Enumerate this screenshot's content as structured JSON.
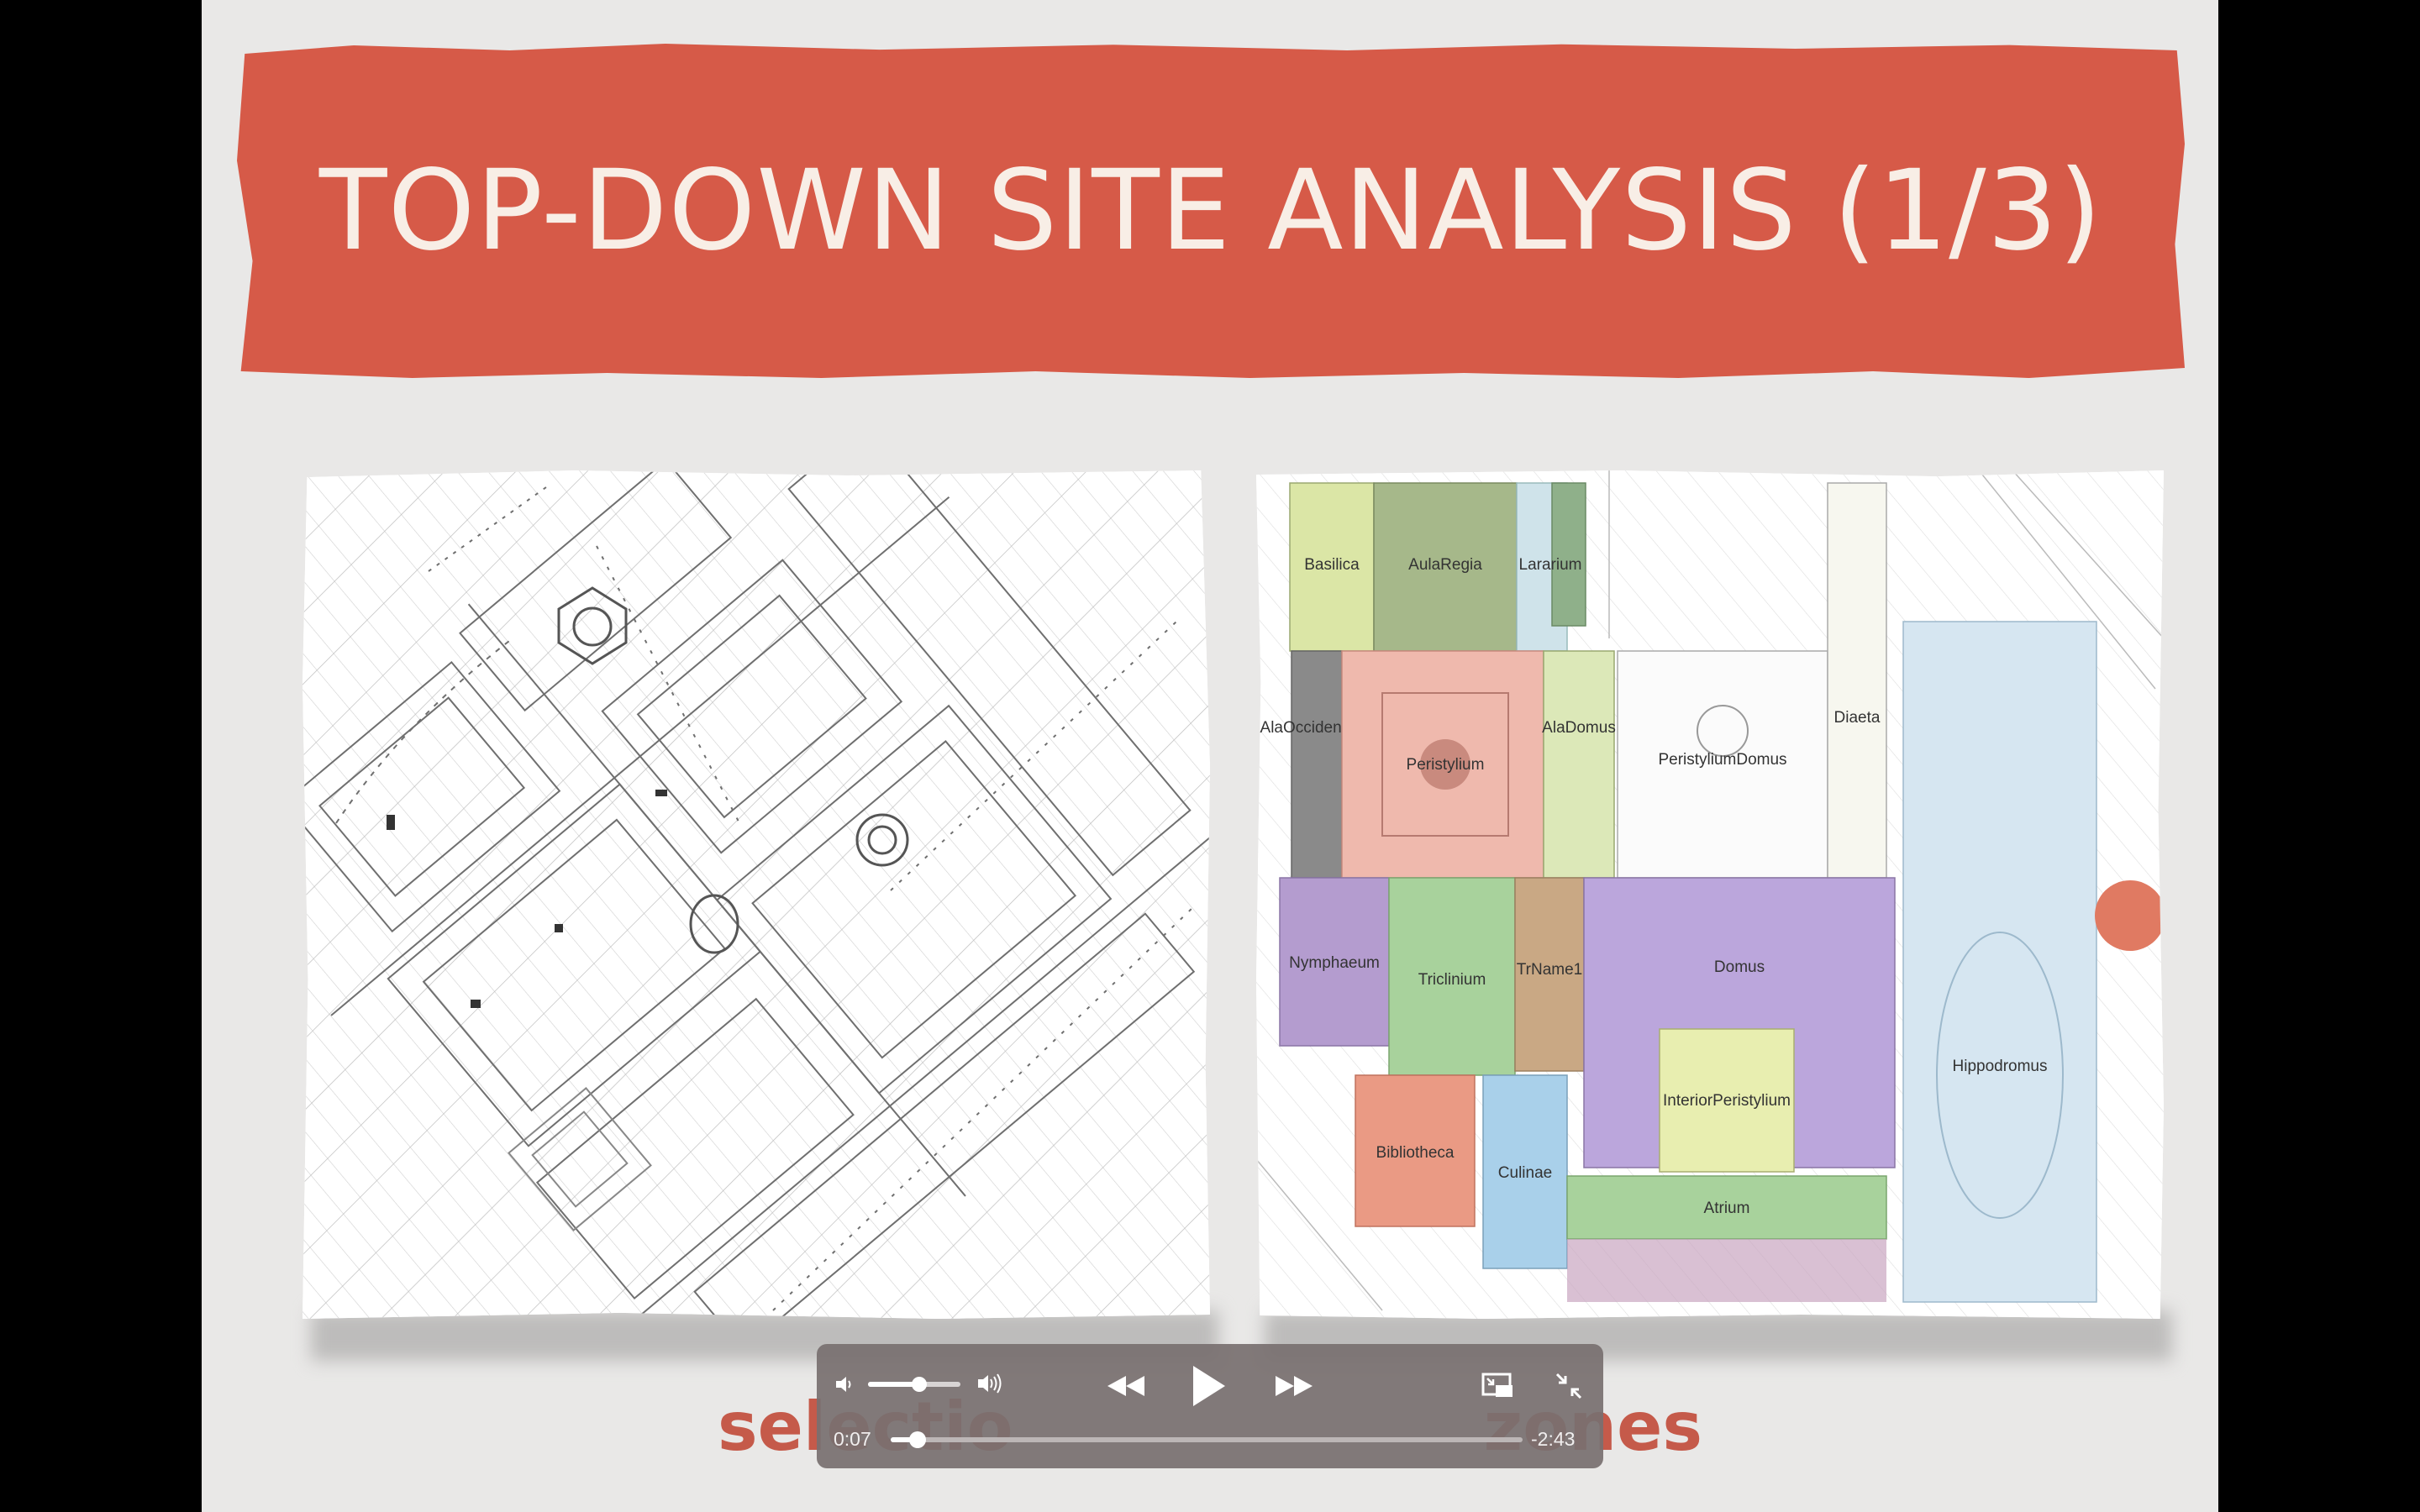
{
  "slide": {
    "title": "TOP-DOWN SITE ANALYSIS (1/3)",
    "subtitle_left": "selectio",
    "subtitle_right": "zones"
  },
  "map_right": {
    "zones": [
      {
        "id": "basilica",
        "label": "Basilica",
        "color": "#dbe6a6"
      },
      {
        "id": "aula-regia",
        "label": "AulaRegia",
        "color": "#a6b88a"
      },
      {
        "id": "lararium",
        "label": "Lararium",
        "color": "#cfe3ea"
      },
      {
        "id": "aula-occidentalis",
        "label": "AlaOccidentalis",
        "color": "#8a8a8a"
      },
      {
        "id": "peristylium",
        "label": "Peristylium",
        "color": "#efb9ad"
      },
      {
        "id": "ala-domus",
        "label": "AlaDomus",
        "color": "#dce8b8"
      },
      {
        "id": "peristylium-domus",
        "label": "PeristyliumDomus",
        "color": "#ffffff"
      },
      {
        "id": "diaeta",
        "label": "Diaeta",
        "color": "#ffffff"
      },
      {
        "id": "nymphaeum",
        "label": "Nymphaeum",
        "color": "#b49ccf"
      },
      {
        "id": "triclinium",
        "label": "Triclinium",
        "color": "#a8d29c"
      },
      {
        "id": "trname1",
        "label": "TrName1",
        "color": "#c9a884"
      },
      {
        "id": "domus",
        "label": "Domus",
        "color": "#bba6dc"
      },
      {
        "id": "hippodromus",
        "label": "Hippodromus",
        "color": "#d6e6f1"
      },
      {
        "id": "interior-peristylium",
        "label": "InteriorPeristylium",
        "color": "#e8eeb0"
      },
      {
        "id": "bibliotheca",
        "label": "Bibliotheca",
        "color": "#ea9a84"
      },
      {
        "id": "culinae",
        "label": "Culinae",
        "color": "#a9d0ea"
      },
      {
        "id": "atrium",
        "label": "Atrium",
        "color": "#a8d29c"
      }
    ]
  },
  "player": {
    "time_current": "0:07",
    "time_remaining": "-2:43",
    "volume": 0.55,
    "progress": 0.043,
    "icons": [
      "volume-low-icon",
      "volume-high-icon",
      "rewind-icon",
      "play-icon",
      "fast-forward-icon",
      "picture-in-picture-icon",
      "exit-fullscreen-icon"
    ]
  }
}
